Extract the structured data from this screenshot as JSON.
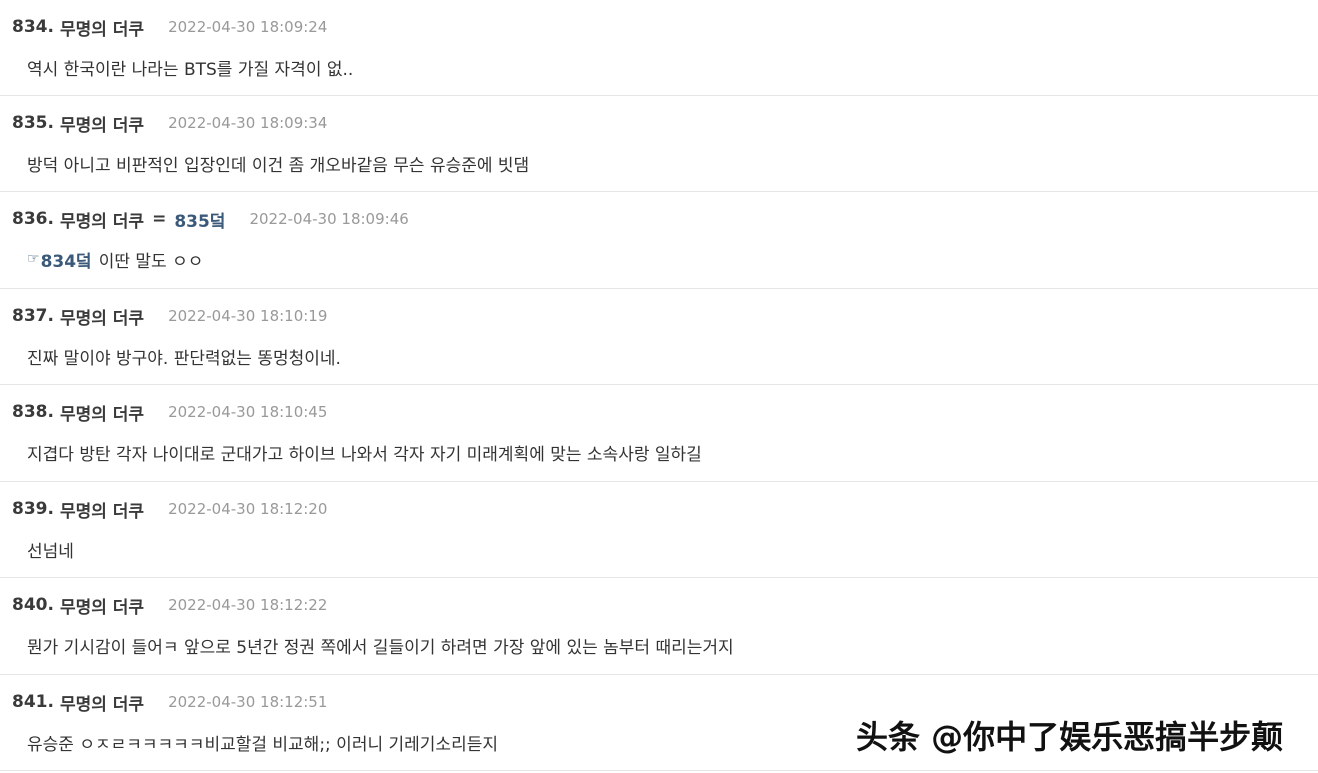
{
  "comments": [
    {
      "number": "834.",
      "author": "무명의 더쿠",
      "time": "2022-04-30 18:09:24",
      "text": "역시 한국이란 나라는 BTS를 가질 자격이 없.."
    },
    {
      "number": "835.",
      "author": "무명의 더쿠",
      "time": "2022-04-30 18:09:34",
      "text": "방덕 아니고 비판적인 입장인데 이건 좀 개오바같음 무슨 유승준에 빗댐"
    },
    {
      "number": "836.",
      "author": "무명의 더쿠",
      "reply_sep": "=",
      "reply_target": "835덬",
      "time": "2022-04-30 18:09:46",
      "ref_icon": "☞",
      "ref": "834덬",
      "text": "이딴 말도 ㅇㅇ"
    },
    {
      "number": "837.",
      "author": "무명의 더쿠",
      "time": "2022-04-30 18:10:19",
      "text": "진짜 말이야 방구야. 판단력없는 똥멍청이네."
    },
    {
      "number": "838.",
      "author": "무명의 더쿠",
      "time": "2022-04-30 18:10:45",
      "text": "지겹다 방탄 각자 나이대로 군대가고 하이브 나와서 각자 자기 미래계획에 맞는 소속사랑 일하길"
    },
    {
      "number": "839.",
      "author": "무명의 더쿠",
      "time": "2022-04-30 18:12:20",
      "text": "선넘네"
    },
    {
      "number": "840.",
      "author": "무명의 더쿠",
      "time": "2022-04-30 18:12:22",
      "text": "뭔가 기시감이 들어ㅋ 앞으로 5년간 정권 쪽에서 길들이기 하려면 가장 앞에 있는 놈부터 때리는거지"
    },
    {
      "number": "841.",
      "author": "무명의 더쿠",
      "time": "2022-04-30 18:12:51",
      "text": "유승준 ㅇㅈㄹㅋㅋㅋㅋㅋ비교할걸 비교해;; 이러니 기레기소리듣지"
    }
  ],
  "watermark": "头条 @你中了娱乐恶搞半步颠",
  "colors": {
    "background": "#ffffff",
    "divider": "#e6e6e6",
    "author": "#3a3a3a",
    "timestamp": "#999999",
    "reply_link": "#3b5a7a"
  }
}
